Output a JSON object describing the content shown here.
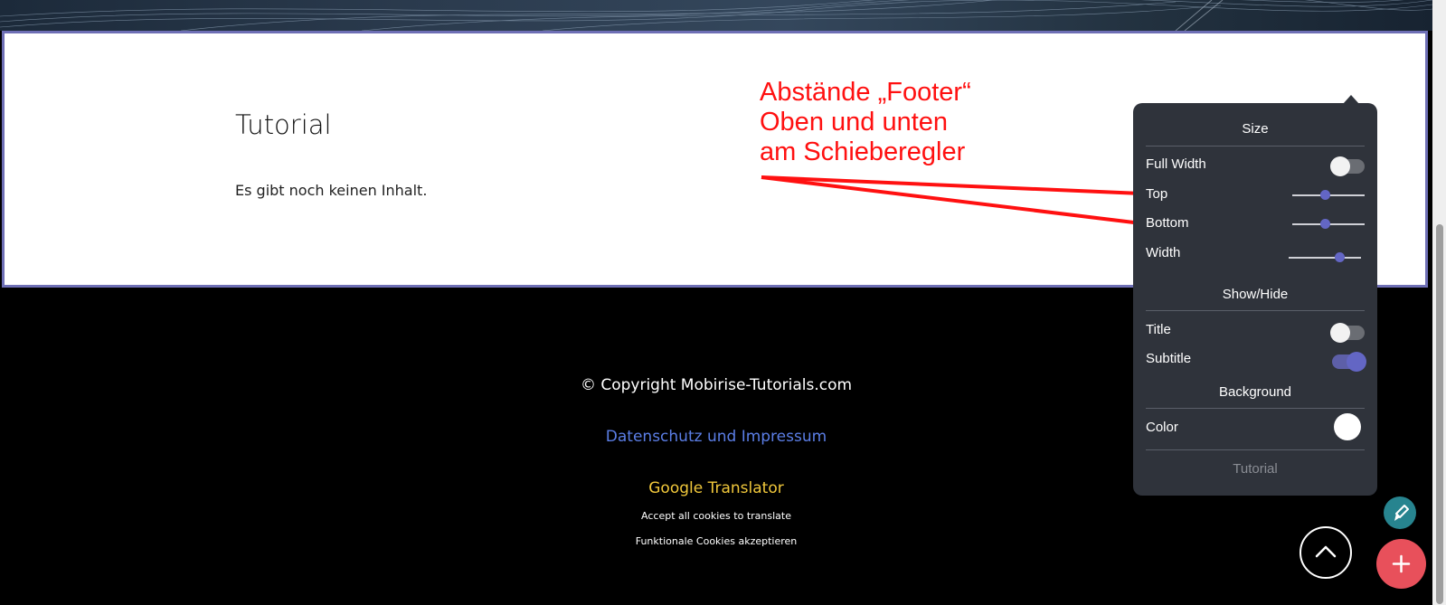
{
  "section": {
    "title": "Tutorial",
    "text": "Es gibt noch keinen Inhalt."
  },
  "annotation": {
    "line1": "Abstände „Footer“",
    "line2": "Oben und unten",
    "line3": "am Schieberegler",
    "color": "#ff1010"
  },
  "footer": {
    "copyright": "© Copyright Mobirise-Tutorials.com",
    "privacy_link": "Datenschutz und Impressum",
    "translator_title": "Google Translator",
    "accept_cookies": "Accept all cookies to translate",
    "functional_cookies": "Funktionale Cookies akzeptieren"
  },
  "panel": {
    "size_heading": "Size",
    "full_width_label": "Full Width",
    "full_width_on": false,
    "top_label": "Top",
    "top_value": 0.45,
    "bottom_label": "Bottom",
    "bottom_value": 0.45,
    "width_label": "Width",
    "width_value": 0.7,
    "showhide_heading": "Show/Hide",
    "title_label": "Title",
    "title_on": false,
    "subtitle_label": "Subtitle",
    "subtitle_on": true,
    "background_heading": "Background",
    "color_label": "Color",
    "color_value": "#ffffff",
    "footer_label": "Tutorial"
  },
  "colors": {
    "accent": "#6366c4",
    "panel_bg": "#2f333b",
    "link": "#5b7ee6",
    "translator": "#f1c83b",
    "add_button": "#e8505b",
    "edit_button": "#27848f"
  },
  "icons": {
    "scroll_top": "chevron-up-icon",
    "edit": "brush-icon",
    "add": "plus-icon"
  }
}
